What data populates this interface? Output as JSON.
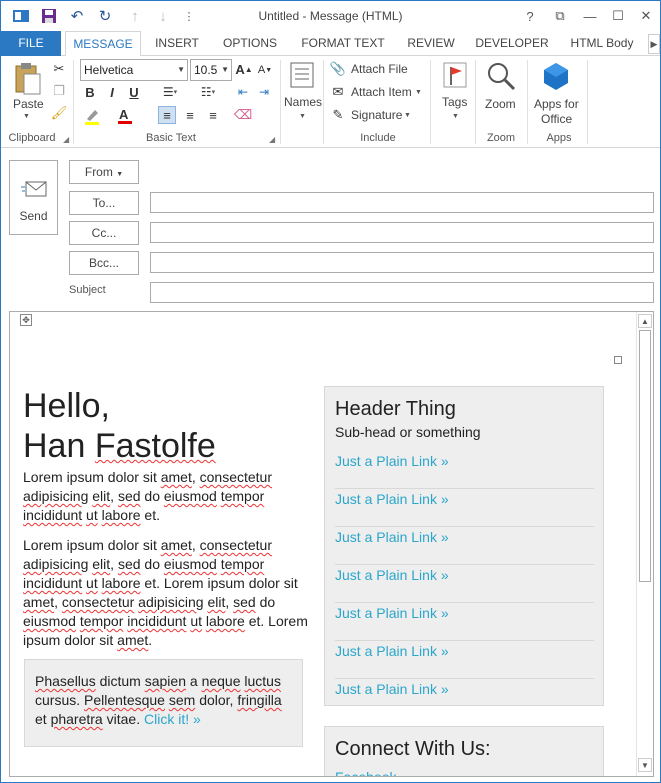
{
  "window": {
    "title": "Untitled - Message (HTML)",
    "controls": {
      "help": "?",
      "restore": "⧉",
      "minimize": "—",
      "maximize": "☐",
      "close": "✕"
    }
  },
  "quick_access": {
    "save": "save-icon",
    "undo": "undo-icon",
    "redo": "redo-icon",
    "up": "up-arrow-icon",
    "down": "down-arrow-icon",
    "more": "more-icon"
  },
  "tabs": [
    "FILE",
    "MESSAGE",
    "INSERT",
    "OPTIONS",
    "FORMAT TEXT",
    "REVIEW",
    "DEVELOPER",
    "HTML Body"
  ],
  "ribbon": {
    "clipboard": {
      "paste": "Paste",
      "group": "Clipboard"
    },
    "basic_text": {
      "font": "Helvetica",
      "size": "10.5",
      "bold": "B",
      "italic": "I",
      "underline": "U",
      "group": "Basic Text"
    },
    "names": {
      "label": "Names"
    },
    "include": {
      "attach_file": "Attach File",
      "attach_item": "Attach Item",
      "signature": "Signature",
      "group": "Include"
    },
    "tags": {
      "label": "Tags"
    },
    "zoom": {
      "label": "Zoom",
      "group": "Zoom"
    },
    "apps": {
      "label1": "Apps for",
      "label2": "Office",
      "group": "Apps"
    }
  },
  "header": {
    "send": "Send",
    "from": "From",
    "to": "To...",
    "cc": "Cc...",
    "bcc": "Bcc...",
    "subject": "Subject"
  },
  "email": {
    "hello1": "Hello,",
    "hello2": "Han Fastolfe",
    "panel": {
      "title": "Header Thing",
      "subhead": "Sub-head or something",
      "links": [
        "Just a Plain Link »",
        "Just a Plain Link »",
        "Just a Plain Link »",
        "Just a Plain Link »",
        "Just a Plain Link »",
        "Just a Plain Link »",
        "Just a Plain Link »"
      ]
    },
    "connect": {
      "title": "Connect With Us:",
      "facebook": "Facebook"
    },
    "callout_link": "Click it! »"
  },
  "colors": {
    "accent": "#2b79c2",
    "link": "#2ba6cb"
  }
}
